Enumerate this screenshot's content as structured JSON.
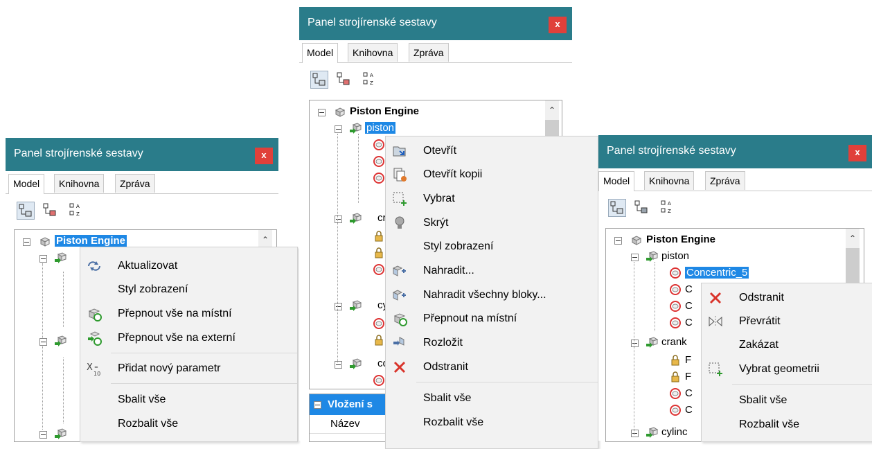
{
  "panels": [
    {
      "title": "Panel strojírenské sestavy",
      "close": "x",
      "tabs": [
        "Model",
        "Knihovna",
        "Zpráva"
      ],
      "tree": {
        "root": "Piston Engine"
      },
      "menu": {
        "items": [
          {
            "label": "Aktualizovat",
            "icon": "update-icon"
          },
          {
            "label": "Styl zobrazení",
            "icon": ""
          },
          {
            "label": "Přepnout vše na místní",
            "icon": "switch-local-icon"
          },
          {
            "label": "Přepnout vše na externí",
            "icon": "switch-external-icon"
          },
          {
            "label": "Přidat nový parametr",
            "icon": "add-parameter-icon"
          },
          {
            "label": "Sbalit vše",
            "icon": ""
          },
          {
            "label": "Rozbalit vše",
            "icon": ""
          }
        ]
      }
    },
    {
      "title": "Panel strojírenské sestavy",
      "close": "x",
      "tabs": [
        "Model",
        "Knihovna",
        "Zpráva"
      ],
      "tree": {
        "root": "Piston Engine",
        "child": "piston",
        "partial": [
          "cr",
          "cy",
          "co"
        ]
      },
      "props": {
        "header": "Vložení s",
        "row1": "Název"
      },
      "menu": {
        "items": [
          {
            "label": "Otevřít",
            "icon": "open-icon"
          },
          {
            "label": "Otevřít kopii",
            "icon": "open-copy-icon"
          },
          {
            "label": "Vybrat",
            "icon": "select-icon"
          },
          {
            "label": "Skrýt",
            "icon": "hide-bulb-icon"
          },
          {
            "label": "Styl zobrazení",
            "icon": ""
          },
          {
            "label": "Nahradit...",
            "icon": "replace-icon"
          },
          {
            "label": "Nahradit všechny bloky...",
            "icon": "replace-all-icon"
          },
          {
            "label": "Přepnout na místní",
            "icon": "switch-local-icon"
          },
          {
            "label": "Rozložit",
            "icon": "explode-icon"
          },
          {
            "label": "Odstranit",
            "icon": "delete-icon"
          },
          {
            "label": "Sbalit vše",
            "icon": ""
          },
          {
            "label": "Rozbalit vše",
            "icon": ""
          }
        ]
      }
    },
    {
      "title": "Panel strojírenské sestavy",
      "close": "x",
      "tabs": [
        "Model",
        "Knihovna",
        "Zpráva"
      ],
      "tree": {
        "root": "Piston Engine",
        "child": "piston",
        "selected": "Concentric_5",
        "partial": [
          "C",
          "C",
          "C",
          "crank",
          "F",
          "F",
          "C",
          "C",
          "cylinc"
        ]
      },
      "menu": {
        "items": [
          {
            "label": "Odstranit",
            "icon": "delete-icon"
          },
          {
            "label": "Převrátit",
            "icon": "flip-icon"
          },
          {
            "label": "Zakázat",
            "icon": ""
          },
          {
            "label": "Vybrat geometrii",
            "icon": "select-geometry-icon"
          },
          {
            "label": "Sbalit vše",
            "icon": ""
          },
          {
            "label": "Rozbalit vše",
            "icon": ""
          }
        ]
      }
    }
  ],
  "colors": {
    "titlebar": "#2a7c8a",
    "close": "#e0403a",
    "selection": "#1e88e5",
    "menu": "#f2f2f2"
  }
}
